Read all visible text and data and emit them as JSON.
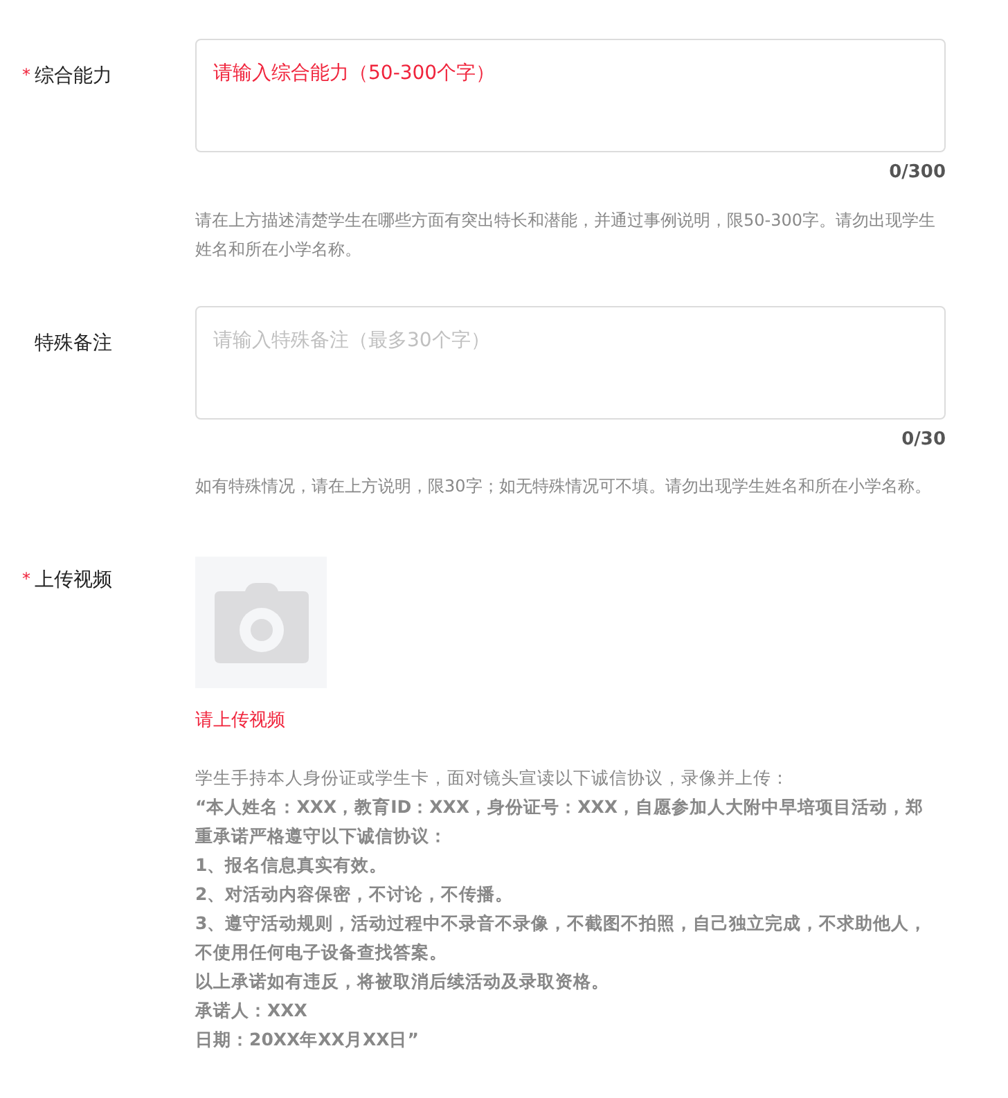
{
  "fields": [
    {
      "kind": "textarea",
      "label": "综合能力",
      "required_mark": "*",
      "placeholder": "请输入综合能力（50-300个字）",
      "error": true,
      "counter": "0/300",
      "hint": "请在上方描述清楚学生在哪些方面有突出特长和潜能，并通过事例说明，限50-300字。请勿出现学生姓名和所在小学名称。"
    },
    {
      "kind": "textarea",
      "label": "特殊备注",
      "placeholder": "请输入特殊备注（最多30个字）",
      "error": false,
      "counter": "0/30",
      "hint": "如有特殊情况，请在上方说明，限30字；如无特殊情况可不填。请勿出现学生姓名和所在小学名称。"
    },
    {
      "kind": "upload",
      "label": "上传视频",
      "required_mark": "*",
      "error_message": "请上传视频",
      "instructions": [
        {
          "text": "学生手持本人身份证或学生卡，面对镜头宣读以下诚信协议，录像并上传：",
          "bold": false
        },
        {
          "text": "“本人姓名：XXX，教育ID：XXX，身份证号：XXX，自愿参加人大附中早培项目活动，郑重承诺严格遵守以下诚信协议：",
          "bold": true
        },
        {
          "text": "1、报名信息真实有效。",
          "bold": true
        },
        {
          "text": "2、对活动内容保密，不讨论，不传播。",
          "bold": true
        },
        {
          "text": "3、遵守活动规则，活动过程中不录音不录像，不截图不拍照，自己独立完成，不求助他人，不使用任何电子设备查找答案。",
          "bold": true
        },
        {
          "text": "以上承诺如有违反，将被取消后续活动及录取资格。",
          "bold": true
        },
        {
          "text": "承诺人：XXX",
          "bold": true
        },
        {
          "text": "日期：20XX年XX月XX日”",
          "bold": true
        }
      ]
    }
  ]
}
